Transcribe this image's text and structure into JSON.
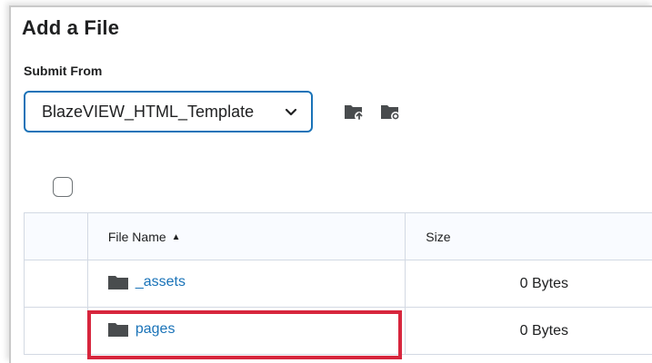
{
  "dialog": {
    "title": "Add a File",
    "submit_from_label": "Submit From",
    "submit_from_value": "BlazeVIEW_HTML_Template"
  },
  "toolbar": {
    "icons": [
      "upload-folder-icon",
      "folder-settings-icon"
    ]
  },
  "table": {
    "headers": {
      "name": "File Name",
      "size": "Size"
    },
    "sort_indicator": "▲",
    "rows": [
      {
        "name": "_assets",
        "size": "0 Bytes",
        "icon": "folder-icon"
      },
      {
        "name": "pages",
        "size": "0 Bytes",
        "icon": "folder-icon",
        "highlighted": true
      }
    ]
  },
  "colors": {
    "accent": "#1a73b8",
    "highlight": "#d7263d",
    "header_bg": "#f9fbff"
  }
}
